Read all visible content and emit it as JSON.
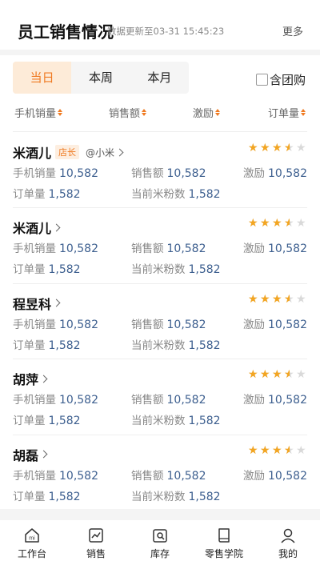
{
  "header": {
    "title": "员工销售情况",
    "updated": "数据更新至03-31 15:45:23",
    "more": "更多"
  },
  "tabs": [
    {
      "label": "当日",
      "active": true
    },
    {
      "label": "本周",
      "active": false
    },
    {
      "label": "本月",
      "active": false
    }
  ],
  "filter": {
    "group_buy_label": "含团购",
    "checked": false
  },
  "sort_headers": [
    "手机销量",
    "销售额",
    "激励",
    "订单量"
  ],
  "labels": {
    "phone_sales": "手机销量",
    "sales_amount": "销售额",
    "incentive": "激励",
    "orders": "订单量",
    "fans": "当前米粉数"
  },
  "employees": [
    {
      "name": "米酒儿",
      "badge": "店长",
      "handle": "@小米",
      "rating": 3.5,
      "phone_sales": "10,582",
      "sales_amount": "10,582",
      "incentive": "10,582",
      "orders": "1,582",
      "fans": "1,582"
    },
    {
      "name": "米酒儿",
      "badge": "",
      "handle": "",
      "rating": 3.5,
      "phone_sales": "10,582",
      "sales_amount": "10,582",
      "incentive": "10,582",
      "orders": "1,582",
      "fans": "1,582"
    },
    {
      "name": "程昱科",
      "badge": "",
      "handle": "",
      "rating": 3.5,
      "phone_sales": "10,582",
      "sales_amount": "10,582",
      "incentive": "10,582",
      "orders": "1,582",
      "fans": "1,582"
    },
    {
      "name": "胡萍",
      "badge": "",
      "handle": "",
      "rating": 3.5,
      "phone_sales": "10,582",
      "sales_amount": "10,582",
      "incentive": "10,582",
      "orders": "1,582",
      "fans": "1,582"
    },
    {
      "name": "胡磊",
      "badge": "",
      "handle": "",
      "rating": 3.5,
      "phone_sales": "10,582",
      "sales_amount": "10,582",
      "incentive": "10,582",
      "orders": "1,582",
      "fans": "1,582"
    }
  ],
  "tabbar": [
    {
      "label": "工作台",
      "icon": "home-icon"
    },
    {
      "label": "销售",
      "icon": "sales-chart-icon"
    },
    {
      "label": "库存",
      "icon": "inventory-icon"
    },
    {
      "label": "零售学院",
      "icon": "book-icon"
    },
    {
      "label": "我的",
      "icon": "profile-icon"
    }
  ],
  "colors": {
    "accent": "#ef7a22",
    "value": "#3d5f8f",
    "star": "#f3a521"
  }
}
